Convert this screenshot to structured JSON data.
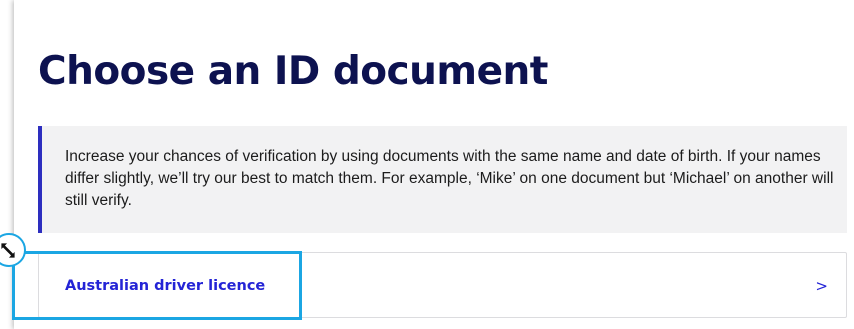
{
  "page": {
    "title": "Choose an ID document"
  },
  "info": {
    "text": "Increase your chances of verification by using documents with the same name and date of birth. If your names differ slightly, we’ll try our best to match them. For example, ‘Mike’ on one document but ‘Michael’ on another will still verify."
  },
  "document_options": [
    {
      "label": "Australian driver licence",
      "chevron": ">"
    }
  ],
  "colors": {
    "title": "#0d1250",
    "accent_border": "#2d2ebf",
    "link": "#2424d6",
    "info_background": "#f2f2f3",
    "highlight": "#1ba6e3"
  },
  "icons": {
    "cursor": "resize-cursor-icon",
    "option_chevron": "chevron-right-icon"
  }
}
